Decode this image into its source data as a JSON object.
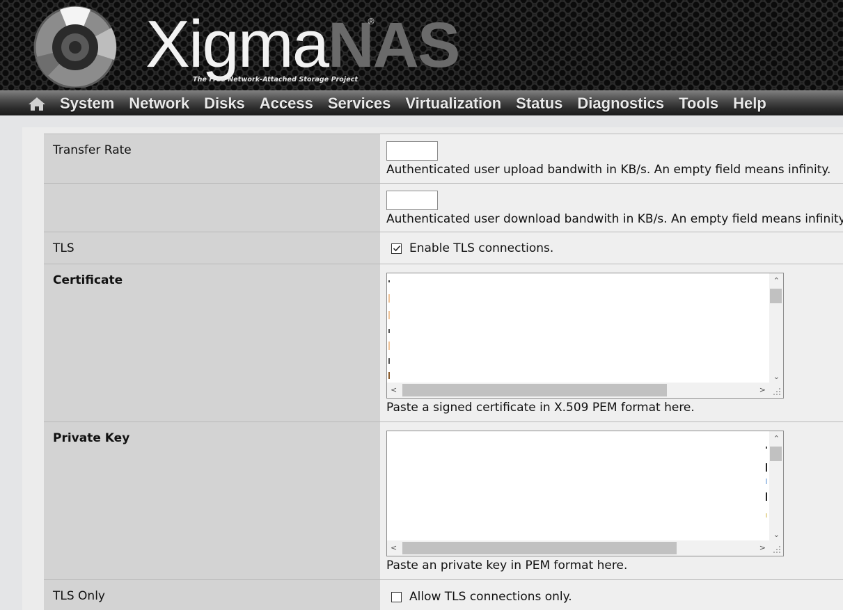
{
  "header": {
    "logo_prefix": "Xigma",
    "logo_suffix": "NAS",
    "logo_registered": "®",
    "tagline": "The Free Network-Attached Storage Project"
  },
  "nav": {
    "home_icon": "home-icon",
    "items": [
      "System",
      "Network",
      "Disks",
      "Access",
      "Services",
      "Virtualization",
      "Status",
      "Diagnostics",
      "Tools",
      "Help"
    ]
  },
  "form": {
    "transfer_rate": {
      "label": "Transfer Rate",
      "upload_value": "",
      "upload_desc": "Authenticated user upload bandwith in KB/s. An empty field means infinity.",
      "download_value": "",
      "download_desc": "Authenticated user download bandwith in KB/s. An empty field means infinity."
    },
    "tls": {
      "label": "TLS",
      "checked": true,
      "checkbox_label": "Enable TLS connections."
    },
    "certificate": {
      "label": "Certificate",
      "value": "",
      "desc": "Paste a signed certificate in X.509 PEM format here."
    },
    "private_key": {
      "label": "Private Key",
      "value": "",
      "desc": "Paste an private key in PEM format here."
    },
    "tls_only": {
      "label": "TLS Only",
      "checked": false,
      "checkbox_label": "Allow TLS connections only."
    }
  },
  "colors": {
    "label_bg": "#d3d3d3",
    "value_bg": "#efefef",
    "nav_text": "#e9e9e9"
  }
}
